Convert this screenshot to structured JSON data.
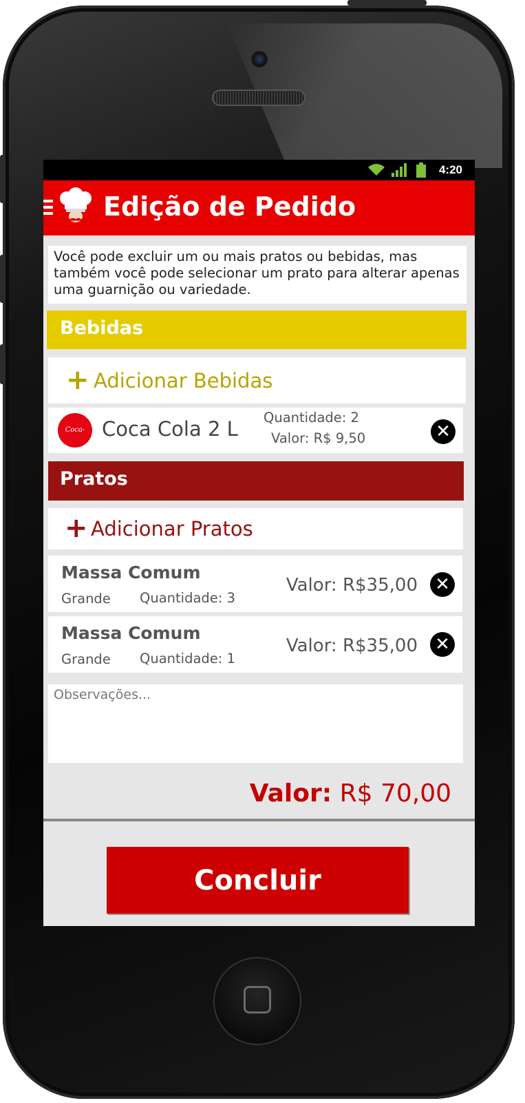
{
  "statusbar": {
    "time": "4:20",
    "icons": [
      "wifi-icon",
      "signal-icon",
      "battery-icon"
    ]
  },
  "appbar": {
    "title": "Edição de Pedido",
    "icons": [
      "menu-icon",
      "chef-hat-icon"
    ]
  },
  "info_text": "Você pode excluir um ou mais pratos ou bebidas, mas também você pode selecionar um prato para alterar apenas uma guarnição ou variedade.",
  "bebidas": {
    "section_title": "Bebidas",
    "add_label": "Adicionar Bebidas",
    "items": [
      {
        "name": "Coca Cola 2 L",
        "quantity": "Quantidade: 2",
        "value": "Valor: R$ 9,50",
        "logo_text": "Coca-Cola"
      }
    ]
  },
  "pratos": {
    "section_title": "Pratos",
    "add_label": "Adicionar Pratos",
    "items": [
      {
        "name": "Massa Comum",
        "size": "Grande",
        "quantity": "Quantidade: 3",
        "value": "Valor: R$35,00"
      },
      {
        "name": "Massa Comum",
        "size": "Grande",
        "quantity": "Quantidade: 1",
        "value": "Valor: R$35,00"
      }
    ]
  },
  "observacoes": {
    "placeholder": "Observações...",
    "value": ""
  },
  "total": {
    "label": "Valor:",
    "amount": "R$ 70,00"
  },
  "actions": {
    "concluir_label": "Concluir"
  },
  "colors": {
    "appbar": "#e60000",
    "bebidas_header": "#e5cc00",
    "bebidas_accent": "#b8a300",
    "pratos_header": "#981212",
    "pratos_accent": "#981212",
    "total": "#c40000",
    "button": "#cc0000"
  }
}
